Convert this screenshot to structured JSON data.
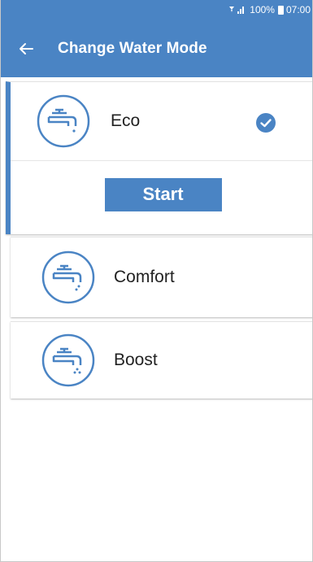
{
  "status_bar": {
    "signal": "⧖ .❙",
    "battery": "100%",
    "time": "07:00"
  },
  "app_bar": {
    "back_icon": "arrow-left-icon",
    "title": "Change Water Mode"
  },
  "modes": [
    {
      "label": "Eco",
      "icon": "tap-eco-icon",
      "selected": true
    },
    {
      "label": "Comfort",
      "icon": "tap-comfort-icon",
      "selected": false
    },
    {
      "label": "Boost",
      "icon": "tap-boost-icon",
      "selected": false
    }
  ],
  "start_button": {
    "label": "Start"
  },
  "colors": {
    "primary": "#4a84c4",
    "background": "#ffffff",
    "text": "#222222"
  }
}
